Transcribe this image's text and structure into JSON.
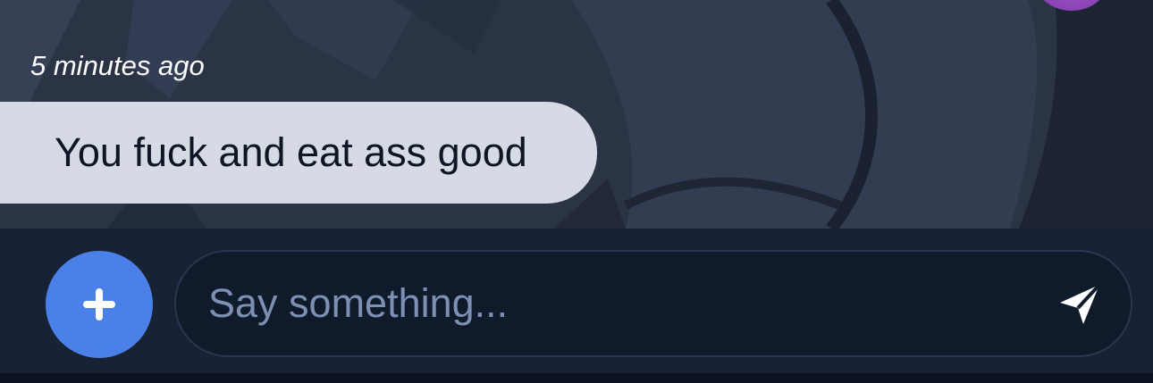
{
  "conversation": {
    "messages": [
      {
        "timestamp": "5 minutes ago",
        "text": "You fuck and eat ass good",
        "direction": "incoming"
      }
    ]
  },
  "composer": {
    "placeholder": "Say something...",
    "add_icon": "plus-icon",
    "send_icon": "paper-plane-send-icon"
  },
  "colors": {
    "accent": "#4a80e8",
    "bubble": "#d5dae4",
    "composer_bg": "#182235",
    "input_bg": "#0f1a2b",
    "placeholder": "#7d90b3"
  }
}
